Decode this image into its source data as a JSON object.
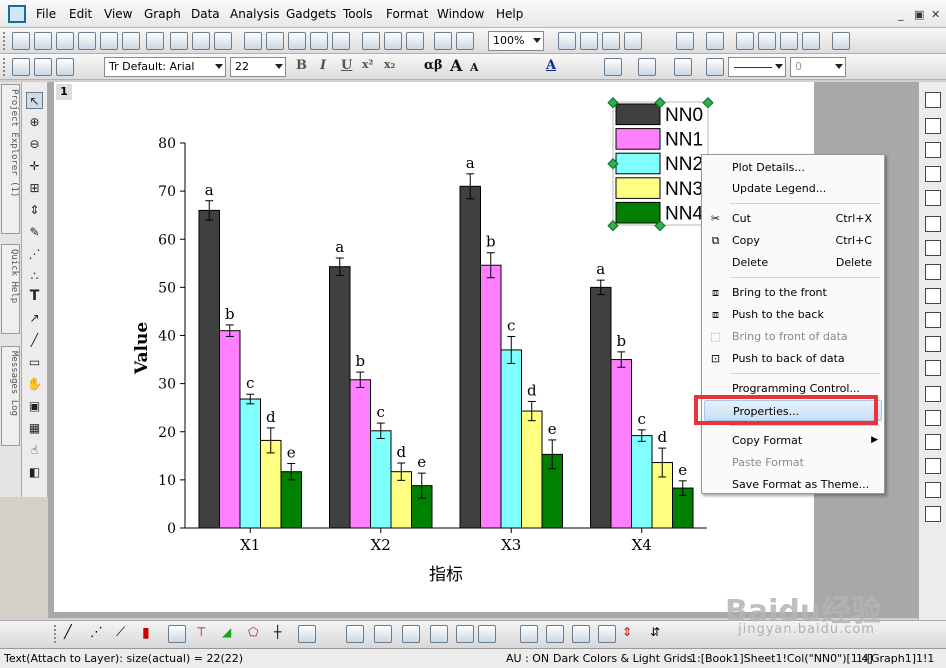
{
  "menu": {
    "items": [
      "File",
      "Edit",
      "View",
      "Graph",
      "Data",
      "Analysis",
      "Gadgets",
      "Tools",
      "Format",
      "Window",
      "Help"
    ]
  },
  "window_controls": [
    "_",
    "▣",
    "✕"
  ],
  "toolbar": {
    "zoom": "100%"
  },
  "format_toolbar": {
    "font": "Tr Default: Arial",
    "size": "22",
    "bold": "B",
    "italic": "I",
    "underline": "U",
    "superscript": "x²",
    "subscript": "x₂",
    "greek": "αβ",
    "grow_font": "A",
    "shrink_font": "A",
    "line_value": "0"
  },
  "left_tabs": [
    "Project Explorer (1)",
    "Quick Help",
    "Messages Log"
  ],
  "page_number": "1",
  "chart_data": {
    "type": "bar",
    "categories": [
      "X1",
      "X2",
      "X3",
      "X4"
    ],
    "xlabel": "指标",
    "ylabel": "Value",
    "ylim": [
      0,
      80
    ],
    "yticks": [
      0,
      10,
      20,
      30,
      40,
      50,
      60,
      70,
      80
    ],
    "series": [
      {
        "name": "NN0",
        "color": "#404040",
        "values": [
          66,
          54.3,
          71,
          50
        ],
        "errors": [
          2,
          1.8,
          2.6,
          1.5
        ],
        "labels": [
          "a",
          "a",
          "a",
          "a"
        ]
      },
      {
        "name": "NN1",
        "color": "#ff80ff",
        "values": [
          41,
          30.8,
          54.6,
          35
        ],
        "errors": [
          1.2,
          1.6,
          2.6,
          1.6
        ],
        "labels": [
          "b",
          "b",
          "b",
          "b"
        ]
      },
      {
        "name": "NN2",
        "color": "#80ffff",
        "values": [
          26.8,
          20.2,
          37,
          19.2
        ],
        "errors": [
          1.0,
          1.6,
          2.8,
          1.2
        ],
        "labels": [
          "c",
          "c",
          "c",
          "c"
        ]
      },
      {
        "name": "NN3",
        "color": "#ffff80",
        "values": [
          18.2,
          11.7,
          24.3,
          13.6
        ],
        "errors": [
          2.6,
          1.8,
          2.0,
          3.0
        ],
        "labels": [
          "d",
          "d",
          "d",
          "d"
        ]
      },
      {
        "name": "NN4",
        "color": "#008000",
        "values": [
          11.7,
          8.8,
          15.3,
          8.3
        ],
        "errors": [
          1.7,
          2.6,
          3.0,
          1.5
        ],
        "labels": [
          "e",
          "e",
          "e",
          "e"
        ]
      }
    ],
    "legend": "top-right"
  },
  "context_menu": {
    "plot_details": "Plot Details...",
    "update_legend": "Update Legend...",
    "cut": "Cut",
    "cut_sc": "Ctrl+X",
    "copy": "Copy",
    "copy_sc": "Ctrl+C",
    "delete": "Delete",
    "delete_sc": "Delete",
    "bring_front": "Bring to the front",
    "push_back": "Push to the back",
    "bring_front_data": "Bring to front of data",
    "push_back_data": "Push to back of data",
    "programming": "Programming Control...",
    "properties": "Properties...",
    "copy_format": "Copy Format",
    "paste_format": "Paste Format",
    "save_format": "Save Format as Theme..."
  },
  "status": {
    "left": "Text(Attach to Layer): size(actual) = 22(22)",
    "au": "AU : ON",
    "theme": "Dark Colors & Light Grids",
    "col": "1:[Book1]Sheet1!Col(\"NN0\")[1:4]",
    "graph": "1:[Graph1]1!1"
  },
  "watermark": {
    "brand": "Baidu经验",
    "url": "jingyan.baidu.com"
  }
}
